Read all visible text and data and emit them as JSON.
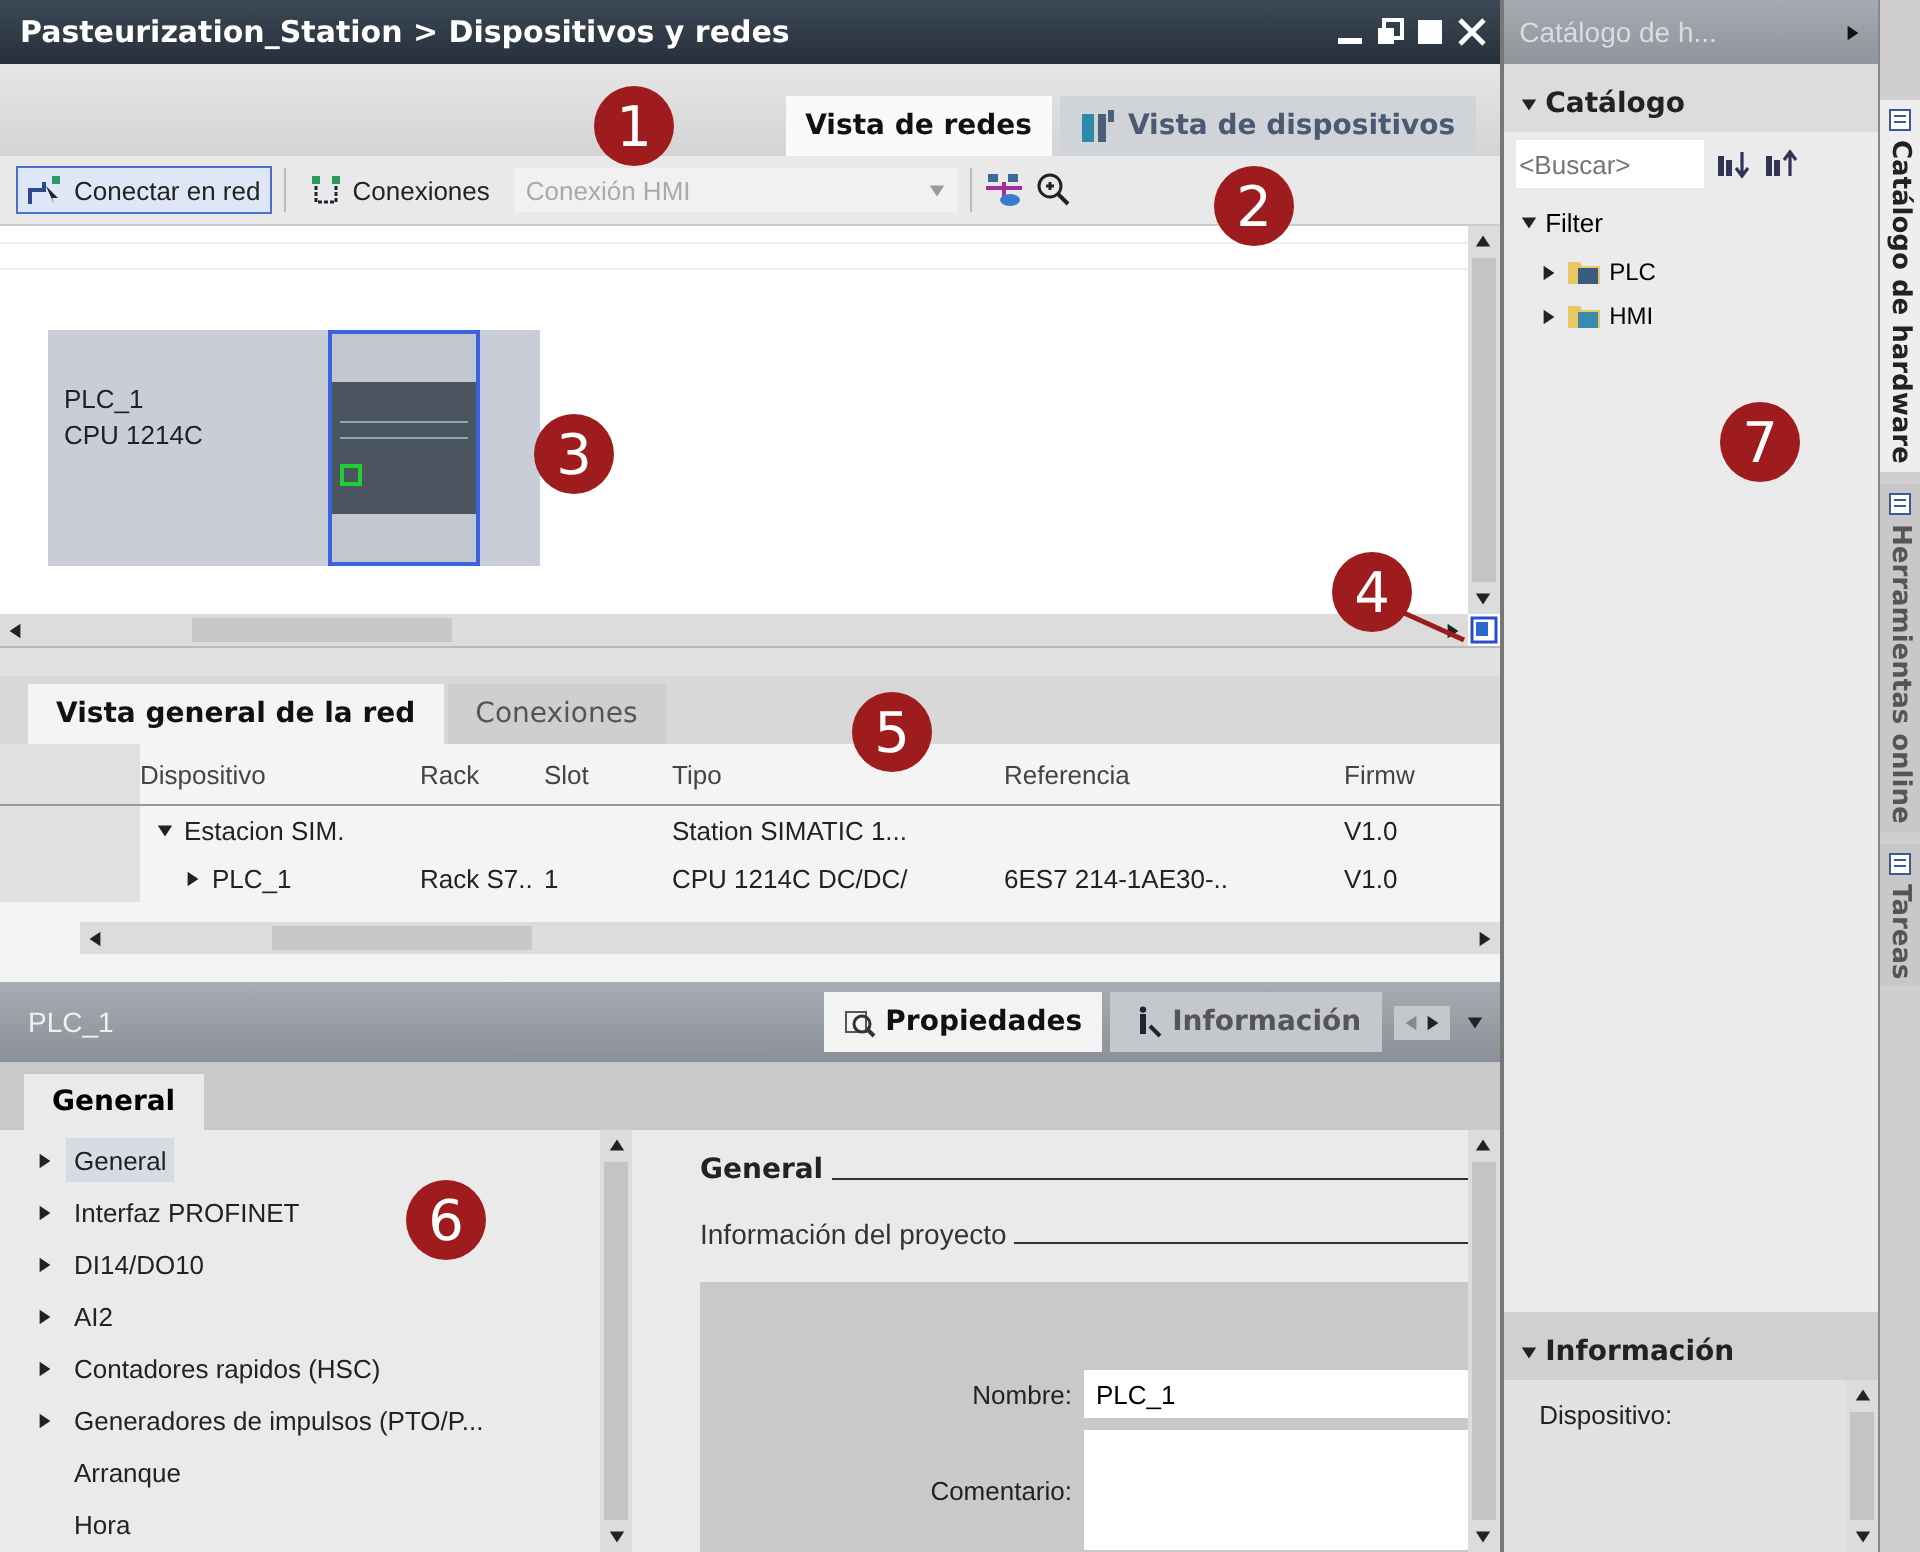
{
  "window": {
    "title": "Pasteurization_Station > Dispositivos y redes"
  },
  "view_tabs": [
    {
      "label": "Vista de redes",
      "selected": true
    },
    {
      "label": "Vista de dispositivos",
      "selected": false
    }
  ],
  "toolbar": {
    "connect_button": {
      "label": "Conectar en red",
      "selected": true
    },
    "connections_button": {
      "label": "Conexiones"
    },
    "connection_type": {
      "value": "Conexión HMI",
      "disabled": true
    }
  },
  "canvas": {
    "device": {
      "name": "PLC_1",
      "model": "CPU 1214C",
      "selected": true
    }
  },
  "overview_tabs": [
    {
      "label": "Vista general de la red",
      "selected": true
    },
    {
      "label": "Conexiones",
      "selected": false
    }
  ],
  "overview_table": {
    "columns": [
      "Dispositivo",
      "Rack",
      "Slot",
      "Tipo",
      "Referencia",
      "Firmw"
    ],
    "rows": [
      {
        "device": "Estacion SIM.",
        "type": "Station SIMATIC 1...",
        "firmware": "V1.0",
        "expanded": true,
        "children": [
          {
            "device": "PLC_1",
            "rack": "Rack S7..",
            "slot": "1",
            "type": "CPU 1214C DC/DC/",
            "reference": "6ES7 214-1AE30-..",
            "firmware": "V1.0",
            "expanded": false
          }
        ]
      }
    ]
  },
  "properties": {
    "title": "PLC_1",
    "tabs": [
      {
        "label": "Propiedades",
        "selected": true
      },
      {
        "label": "Información",
        "selected": false
      }
    ],
    "section_tabs": [
      {
        "label": "General",
        "selected": true
      }
    ],
    "nav_items": [
      {
        "label": "General",
        "expandable": true,
        "selected": true
      },
      {
        "label": "Interfaz PROFINET",
        "expandable": true,
        "selected": false
      },
      {
        "label": "DI14/DO10",
        "expandable": true,
        "selected": false
      },
      {
        "label": "AI2",
        "expandable": true,
        "selected": false
      },
      {
        "label": "Contadores rapidos (HSC)",
        "expandable": true,
        "selected": false
      },
      {
        "label": "Generadores de impulsos (PTO/P...",
        "expandable": true,
        "selected": false
      },
      {
        "label": "Arranque",
        "expandable": false,
        "selected": false
      },
      {
        "label": "Hora",
        "expandable": false,
        "selected": false
      }
    ],
    "heading": "General",
    "subheading": "Información del proyecto",
    "fields": [
      {
        "label": "Nombre:",
        "value": "PLC_1"
      },
      {
        "label": "Comentario:"
      }
    ]
  },
  "catalog": {
    "title": "Catálogo de h...",
    "section": "Catálogo",
    "search": {
      "placeholder": "<Buscar>"
    },
    "filter": {
      "label": "Filter",
      "expanded": true
    },
    "items": [
      {
        "label": "PLC",
        "expanded": false
      },
      {
        "label": "HMI",
        "expanded": false
      }
    ]
  },
  "info": {
    "title": "Información",
    "label": "Dispositivo:"
  },
  "side_tabs": [
    {
      "label": "Catálogo de hardware",
      "selected": true
    },
    {
      "label": "Herramientas online",
      "selected": false
    },
    {
      "label": "Tareas",
      "selected": false
    }
  ],
  "callouts": [
    "1",
    "2",
    "3",
    "4",
    "5",
    "6",
    "7"
  ]
}
